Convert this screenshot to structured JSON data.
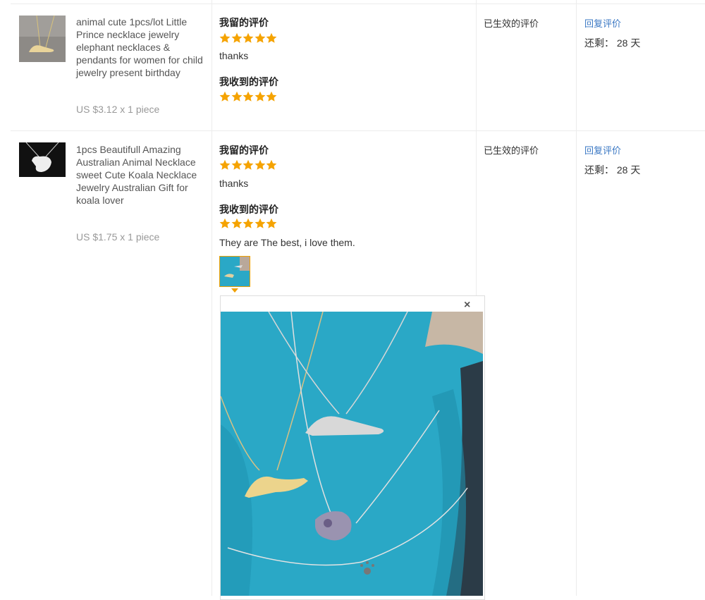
{
  "rows": [
    {
      "product_title": "animal cute 1pcs/lot Little Prince necklace jewelry elephant necklaces & pendants for women for child jewelry present birthday",
      "price": "US $3.12 x 1 piece",
      "my_review_header": "我留的评价",
      "my_rating": 5,
      "my_comment": "thanks",
      "received_review_header": "我收到的评价",
      "received_rating": 5,
      "received_comment": "",
      "status": "已生效的评价",
      "reply_link": "回复评价",
      "remaining": "还剩： 28 天"
    },
    {
      "product_title": "1pcs Beautifull Amazing Australian Animal Necklace sweet Cute Koala Necklace Jewelry Australian Gift for koala lover",
      "price": "US $1.75 x 1 piece",
      "my_review_header": "我留的评价",
      "my_rating": 5,
      "my_comment": "thanks",
      "received_review_header": "我收到的评价",
      "received_rating": 5,
      "received_comment": "They are The best, i love them.",
      "status": "已生效的评价",
      "reply_link": "回复评价",
      "remaining": "还剩： 28 天"
    }
  ],
  "popup": {
    "close_label": "×"
  },
  "colors": {
    "star": "#f5a300",
    "link": "#3b78c4",
    "accent": "#f0a000",
    "photo_bg": "#2aa8c6"
  }
}
